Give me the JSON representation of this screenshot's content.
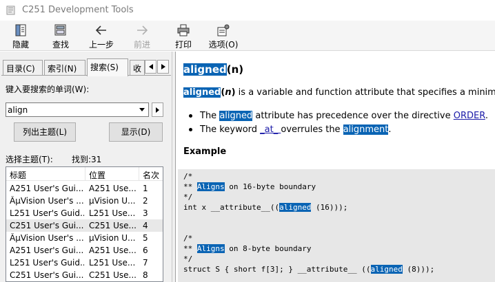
{
  "window": {
    "title": "C251 Development Tools"
  },
  "toolbar": {
    "buttons": [
      {
        "label": "隐藏",
        "icon": "hide-icon"
      },
      {
        "label": "查找",
        "icon": "find-icon"
      },
      {
        "label": "上一步",
        "icon": "back-arrow-icon"
      },
      {
        "label": "前进",
        "icon": "forward-arrow-icon"
      },
      {
        "label": "打印",
        "icon": "printer-icon"
      },
      {
        "label": "选项(O)",
        "icon": "options-icon"
      }
    ]
  },
  "tabs": [
    "目录(C)",
    "索引(N)",
    "搜索(S)",
    "收"
  ],
  "search": {
    "keyword_label": "键入要搜索的单词(W):",
    "value": "align",
    "list_topics_button": "列出主题(L)",
    "display_button": "显示(D)",
    "select_topic_label": "选择主题(T):",
    "found_label": "找到:31"
  },
  "results": {
    "columns": [
      "标题",
      "位置",
      "名次"
    ],
    "rows": [
      {
        "title": "A251 User's Gui...",
        "location": "A251 Use...",
        "rank": "1"
      },
      {
        "title": "ÂµVision User's ...",
        "location": "µVision U...",
        "rank": "2"
      },
      {
        "title": "L251 User's Guid...",
        "location": "L251 Use...",
        "rank": "3"
      },
      {
        "title": "C251 User's Gui...",
        "location": "C251 Use...",
        "rank": "4"
      },
      {
        "title": "ÂµVision User's ...",
        "location": "µVision U...",
        "rank": "5"
      },
      {
        "title": "A251 User's Gui...",
        "location": "A251 Use...",
        "rank": "6"
      },
      {
        "title": "L251 User's Guid...",
        "location": "L251 Use...",
        "rank": "7"
      },
      {
        "title": "C251 User's Gui...",
        "location": "C251 Use...",
        "rank": "8"
      }
    ],
    "selected_index": 3
  },
  "content": {
    "heading_keyword": "aligned",
    "heading_arg": "(n)",
    "intro_keyword": "aligned",
    "intro_open": "(",
    "intro_arg": "n",
    "intro_close": ")",
    "intro_rest": " is a variable and function attribute that specifies a minimum",
    "bullet1_pre": "The ",
    "bullet1_hl": "aligned",
    "bullet1_mid": " attribute has precedence over the directive ",
    "bullet1_link": "ORDER",
    "bullet1_end": ".",
    "bullet2_pre": "The keyword ",
    "bullet2_link": " _at_ ",
    "bullet2_mid": " overrules the ",
    "bullet2_hl": "alignment",
    "bullet2_end": ".",
    "example_heading": "Example",
    "code": {
      "l1": "/*",
      "l2_pre": "** ",
      "l2_hl": "Aligns",
      "l2_post": " on 16-byte boundary",
      "l3": "*/",
      "l4_pre": "int x __attribute__((",
      "l4_hl": "aligned",
      "l4_post": " (16)));",
      "l5": "/*",
      "l6_pre": "** ",
      "l6_hl": "Aligns",
      "l6_post": " on 8-byte boundary",
      "l7": "*/",
      "l8_pre": "struct S { short f[3]; } __attribute__ ((",
      "l8_hl": "aligned",
      "l8_post": " (8)));"
    }
  }
}
